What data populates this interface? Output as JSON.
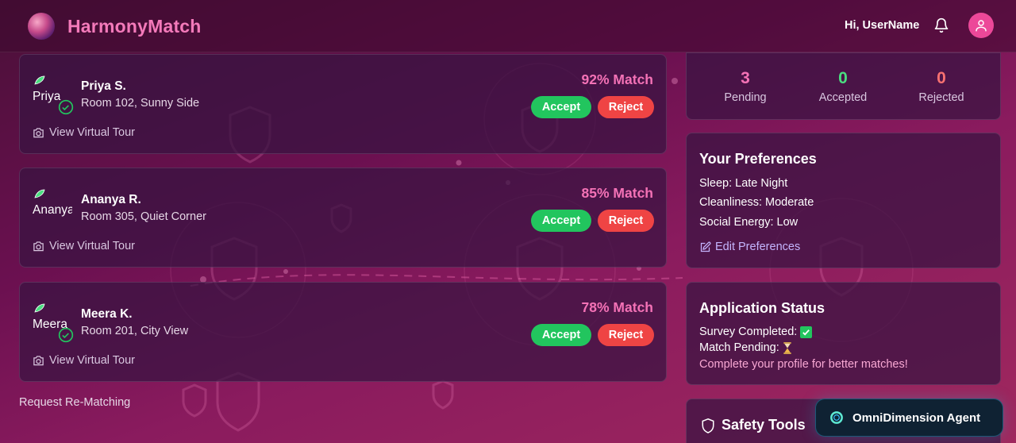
{
  "header": {
    "brand": "HarmonyMatch",
    "greeting": "Hi, UserName",
    "icons": [
      "logo-image",
      "bell-icon",
      "user-avatar-icon"
    ]
  },
  "matches": [
    {
      "image_alt": "Priya",
      "name": "Priya S.",
      "room": "Room 102, Sunny Side",
      "score": "92% Match",
      "tour": "View Virtual Tour",
      "accept": "Accept",
      "reject": "Reject",
      "verified": true
    },
    {
      "image_alt": "Ananya",
      "name": "Ananya R.",
      "room": "Room 305, Quiet Corner",
      "score": "85% Match",
      "tour": "View Virtual Tour",
      "accept": "Accept",
      "reject": "Reject",
      "verified": false
    },
    {
      "image_alt": "Meera",
      "name": "Meera K.",
      "room": "Room 201, City View",
      "score": "78% Match",
      "tour": "View Virtual Tour",
      "accept": "Accept",
      "reject": "Reject",
      "verified": true
    }
  ],
  "rematch_link": "Request Re-Matching",
  "stats": [
    {
      "value": "3",
      "label": "Pending",
      "color": "#f472b6"
    },
    {
      "value": "0",
      "label": "Accepted",
      "color": "#4ade80"
    },
    {
      "value": "0",
      "label": "Rejected",
      "color": "#f87171"
    }
  ],
  "preferences": {
    "title": "Your Preferences",
    "items": [
      "Sleep: Late Night",
      "Cleanliness: Moderate",
      "Social Energy: Low"
    ],
    "edit_label": "Edit Preferences"
  },
  "application_status": {
    "title": "Application Status",
    "survey": "Survey Completed:",
    "pending": "Match Pending:",
    "hint": "Complete your profile for better matches!"
  },
  "safety": {
    "title": "Safety Tools"
  },
  "agent": {
    "label": "OmniDimension Agent"
  },
  "colors": {
    "accent": "#f472b6",
    "accept": "#22c55e",
    "reject": "#ef4444",
    "brand": "#f47aba"
  }
}
